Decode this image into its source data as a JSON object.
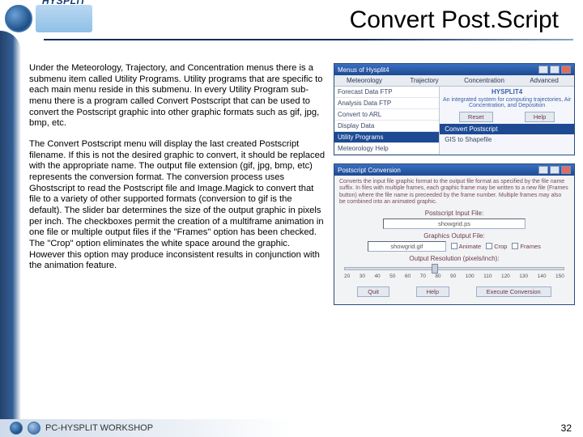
{
  "header": {
    "logo_text": "HYSPLIT",
    "title": "Convert Post.Script"
  },
  "para1": "Under the Meteorology, Trajectory, and Concentration menus there is a submenu item called Utility Programs. Utility programs that are specific to each main menu reside in this submenu. In every Utility Program sub-menu there is a program called Convert Postscript that can be used to convert the Postscript graphic into other graphic formats such as gif, jpg, bmp, etc.",
  "para2": "The Convert Postscript menu will display the last created Postscript filename. If this is not the desired graphic to convert, it should be replaced with the appropriate name. The output file extension (gif, jpg, bmp, etc) represents the conversion format. The conversion process uses Ghostscript to read the Postscript file and Image.Magick to convert that file to a variety of other supported formats (conversion to gif is the default). The slider bar determines the size of the output graphic in pixels per inch. The checkboxes permit the creation of a multiframe animation in one file or multiple output files if the \"Frames\" option has been checked. The \"Crop\" option eliminates the white space around the graphic. However this option may produce inconsistent results in conjunction with the animation feature.",
  "win1": {
    "title": "Menus of Hysplit4",
    "menubar": [
      "Meteorology",
      "Trajectory",
      "Concentration",
      "Advanced"
    ],
    "left": [
      "Forecast Data FTP",
      "Analysis Data FTP",
      "Convert to ARL",
      "Display Data"
    ],
    "left_sel": "Utility Programs",
    "left_last": "Meteorology Help",
    "hy4": "HYSPLIT4",
    "tagline": "An integrated system for computing trajectories, Air Concentration, and Deposition",
    "btn_reset": "Reset",
    "btn_help": "Help",
    "sub_sel": "Convert Postscript",
    "sub2": "GIS to Shapefile"
  },
  "dlg": {
    "title": "Postscript Conversion",
    "blurb": "Converts the input file graphic format to the output file format as specified by the file name suffix. In files with multiple frames, each graphic frame may be written to a new file (Frames button) where the file name is preceeded by the frame number. Multiple frames may also be combined into an animated graphic.",
    "in_lab": "Postscript Input File:",
    "in_val": "showgrid.ps",
    "out_lab": "Graphics Output File:",
    "out_val": "showgrid.gif",
    "cb1": "Animate",
    "cb2": "Crop",
    "cb3": "Frames",
    "res_lab": "Output Resolution (pixels/inch):",
    "ticks": [
      "20",
      "30",
      "40",
      "50",
      "60",
      "70",
      "80",
      "90",
      "100",
      "110",
      "120",
      "130",
      "140",
      "150"
    ],
    "b1": "Quit",
    "b2": "Help",
    "b3": "Execute Conversion"
  },
  "footer": {
    "text": "PC-HYSPLIT WORKSHOP",
    "page": "32"
  }
}
